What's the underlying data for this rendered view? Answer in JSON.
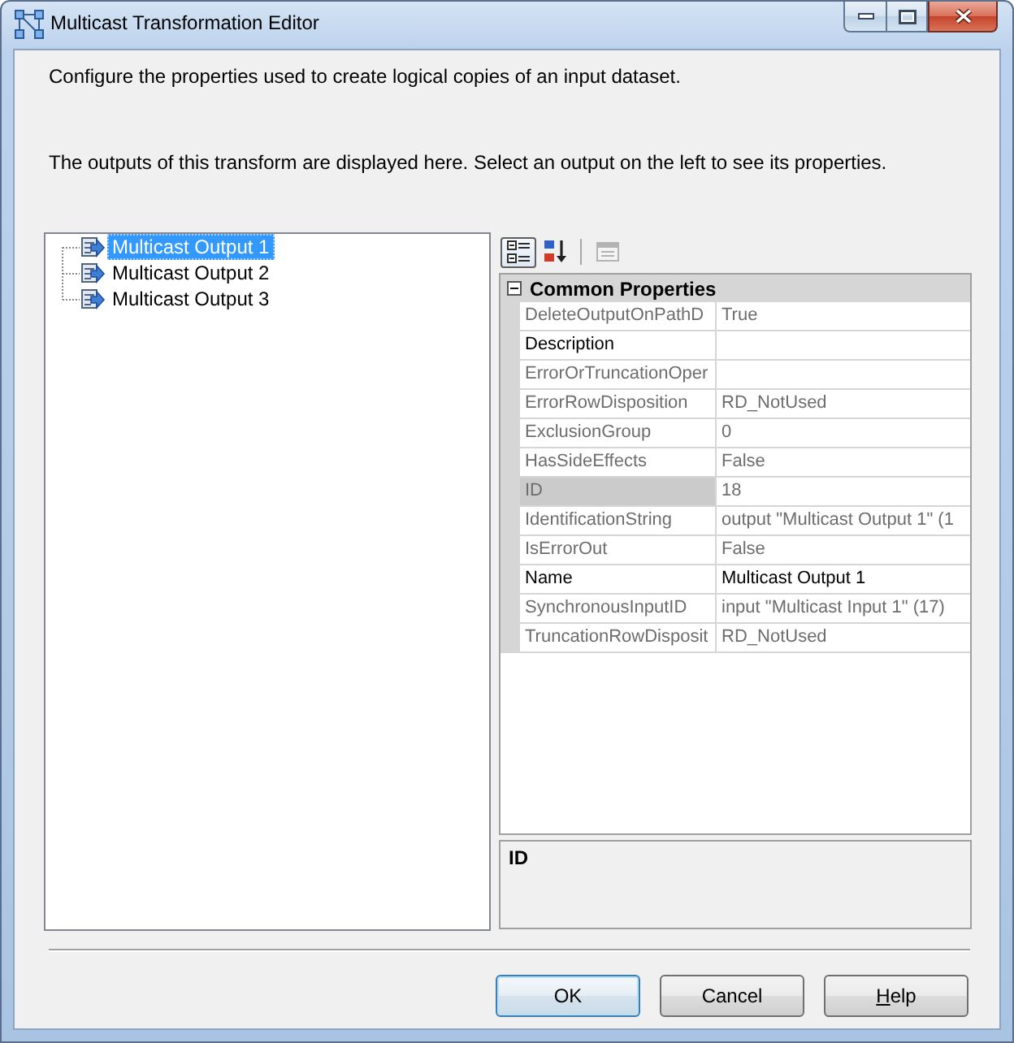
{
  "window": {
    "title": "Multicast Transformation Editor"
  },
  "instructions": [
    "Configure the properties used to create logical copies of an input dataset.",
    "The outputs of this transform are displayed here. Select an output on the left to see its properties."
  ],
  "outputs": [
    {
      "label": "Multicast Output 1",
      "selected": true
    },
    {
      "label": "Multicast Output 2",
      "selected": false
    },
    {
      "label": "Multicast Output 3",
      "selected": false
    }
  ],
  "property_toolbar": [
    {
      "items": [
        {
          "kind": "categorized",
          "selected": true,
          "disabled": false
        },
        {
          "kind": "alphabetical",
          "selected": false,
          "disabled": false
        }
      ]
    },
    {
      "items": [
        {
          "kind": "property_pages",
          "selected": false,
          "disabled": true
        }
      ]
    }
  ],
  "property_grid": {
    "category": {
      "label": "Common Properties",
      "expanded": true
    },
    "rows": [
      {
        "name": "DeleteOutputOnPathD",
        "value": "True",
        "readonly": true,
        "selected": false
      },
      {
        "name": "Description",
        "readonly": false,
        "selected": false
      },
      {
        "name": "ErrorOrTruncationOper",
        "readonly": true,
        "selected": false
      },
      {
        "name": "ErrorRowDisposition",
        "value": "RD_NotUsed",
        "readonly": true,
        "selected": false
      },
      {
        "name": "ExclusionGroup",
        "value": "0",
        "readonly": true,
        "selected": false
      },
      {
        "name": "HasSideEffects",
        "value": "False",
        "readonly": true,
        "selected": false
      },
      {
        "name": "ID",
        "value": "18",
        "readonly": true,
        "selected": true
      },
      {
        "name": "IdentificationString",
        "value": "output \"Multicast Output 1\" (1",
        "readonly": true,
        "selected": false
      },
      {
        "name": "IsErrorOut",
        "value": "False",
        "readonly": true,
        "selected": false
      },
      {
        "name": "Name",
        "value": "Multicast Output 1",
        "readonly": false,
        "selected": false
      },
      {
        "name": "SynchronousInputID",
        "value": "input \"Multicast Input 1\" (17)",
        "readonly": true,
        "selected": false
      },
      {
        "name": "TruncationRowDisposit",
        "value": "RD_NotUsed",
        "readonly": true,
        "selected": false
      }
    ]
  },
  "description_pane": {
    "title": "ID"
  },
  "buttons": [
    {
      "label": "OK",
      "default": true,
      "mnemonic": false
    },
    {
      "label": "Cancel",
      "default": false,
      "mnemonic": false
    },
    {
      "label": "Help",
      "default": false,
      "mnemonic": true
    }
  ]
}
